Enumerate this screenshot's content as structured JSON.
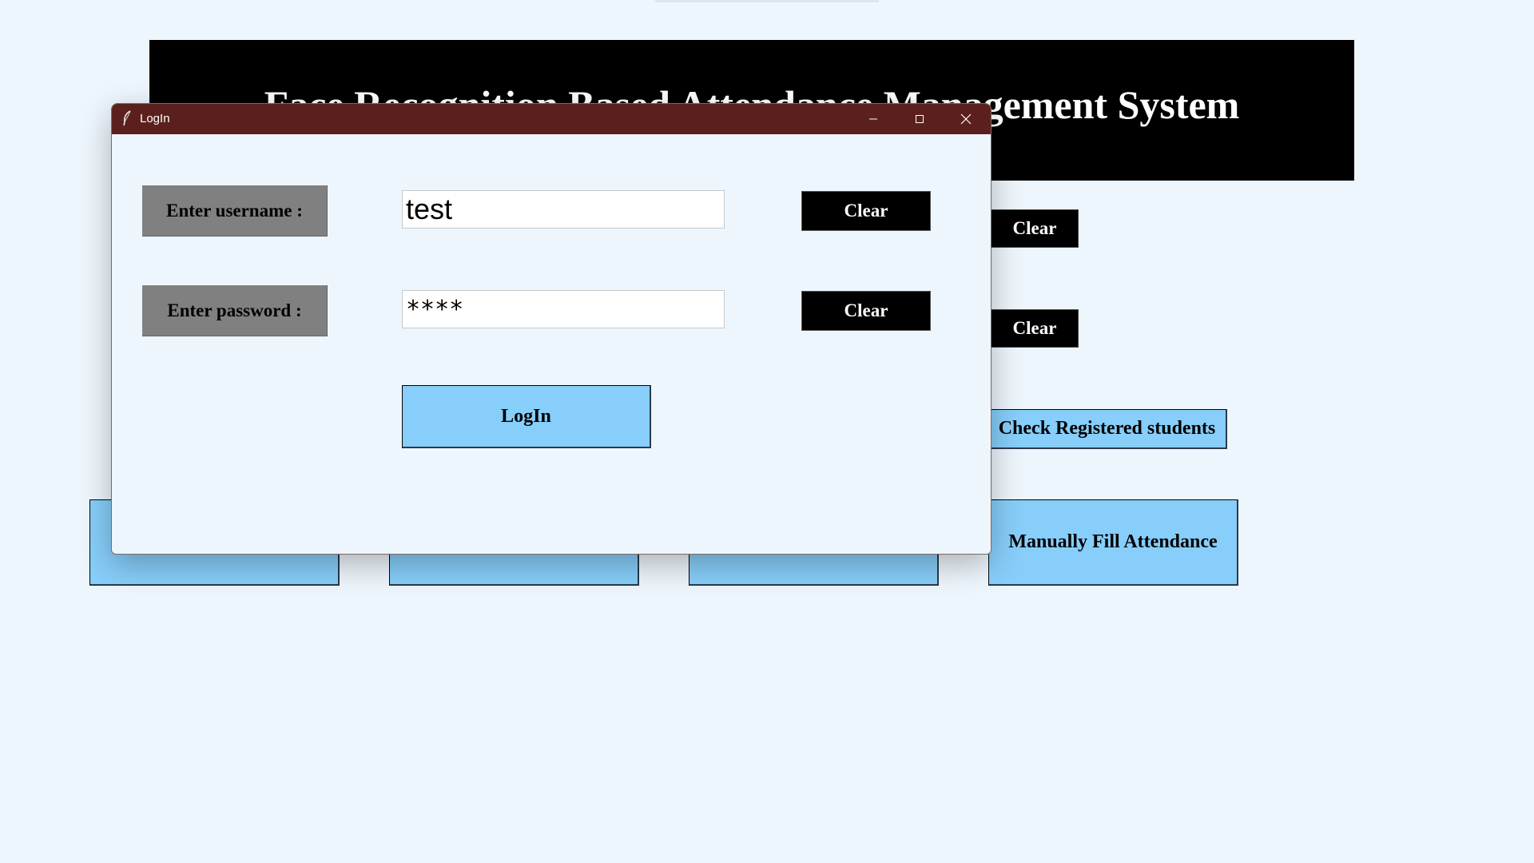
{
  "main_window": {
    "title_visible": "Face Recognition Based Attendance Management System",
    "clear_buttons": [
      "Clear",
      "Clear"
    ],
    "check_registered_label": "Check Registered students",
    "manual_fill_label": "Manually Fill Attendance"
  },
  "login_dialog": {
    "title": "LogIn",
    "username_label": "Enter username :",
    "username_value": "test",
    "password_label": "Enter password :",
    "password_value": "****",
    "clear_label": "Clear",
    "login_label": "LogIn"
  },
  "colors": {
    "background": "#eef6fd",
    "titlebar": "#5b201d",
    "button_blue": "#87cefa",
    "label_gray": "#808080"
  },
  "icons": [
    "feather-icon",
    "minimize-icon",
    "maximize-icon",
    "close-icon"
  ]
}
